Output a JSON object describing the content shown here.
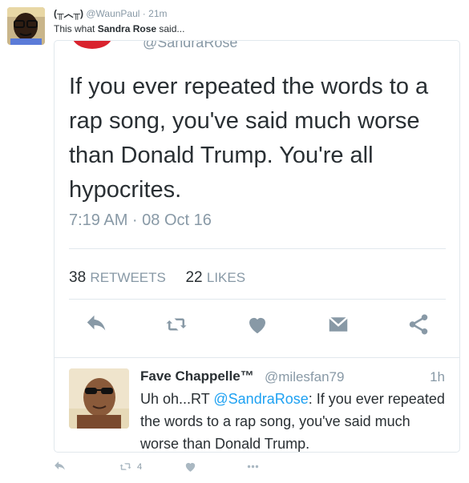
{
  "tweet": {
    "author_name": "(╥︿╥)",
    "author_handle": "@WaunPaul",
    "dot": "·",
    "time": "21m",
    "comment_prefix": "This what ",
    "comment_bold": "Sandra Rose",
    "comment_suffix": " said..."
  },
  "quoted": {
    "handle_peek": "@SandraRose",
    "text": "If you ever repeated the words to a rap song, you've said much worse than Donald Trump. You're all hypocrites.",
    "timestamp": "7:19 AM · 08 Oct 16",
    "retweets_count": "38",
    "retweets_label": "RETWEETS",
    "likes_count": "22",
    "likes_label": "LIKES",
    "actions": [
      "reply-icon",
      "retweet-icon",
      "like-icon",
      "message-icon",
      "share-icon"
    ]
  },
  "reply": {
    "name": "Fave Chappelle™",
    "handle": "@milesfan79",
    "time": "1h",
    "text_prefix": "Uh oh...RT ",
    "mention": "@SandraRose",
    "text_suffix": ": If you ever repeated the words to a rap song, you've said much worse than Donald Trump."
  },
  "bottom_actions": {
    "retweet_count": "4"
  },
  "colors": {
    "muted": "#8899a6",
    "link": "#1da1f2",
    "icon": "#8899a6",
    "border": "#e1e8ed"
  }
}
